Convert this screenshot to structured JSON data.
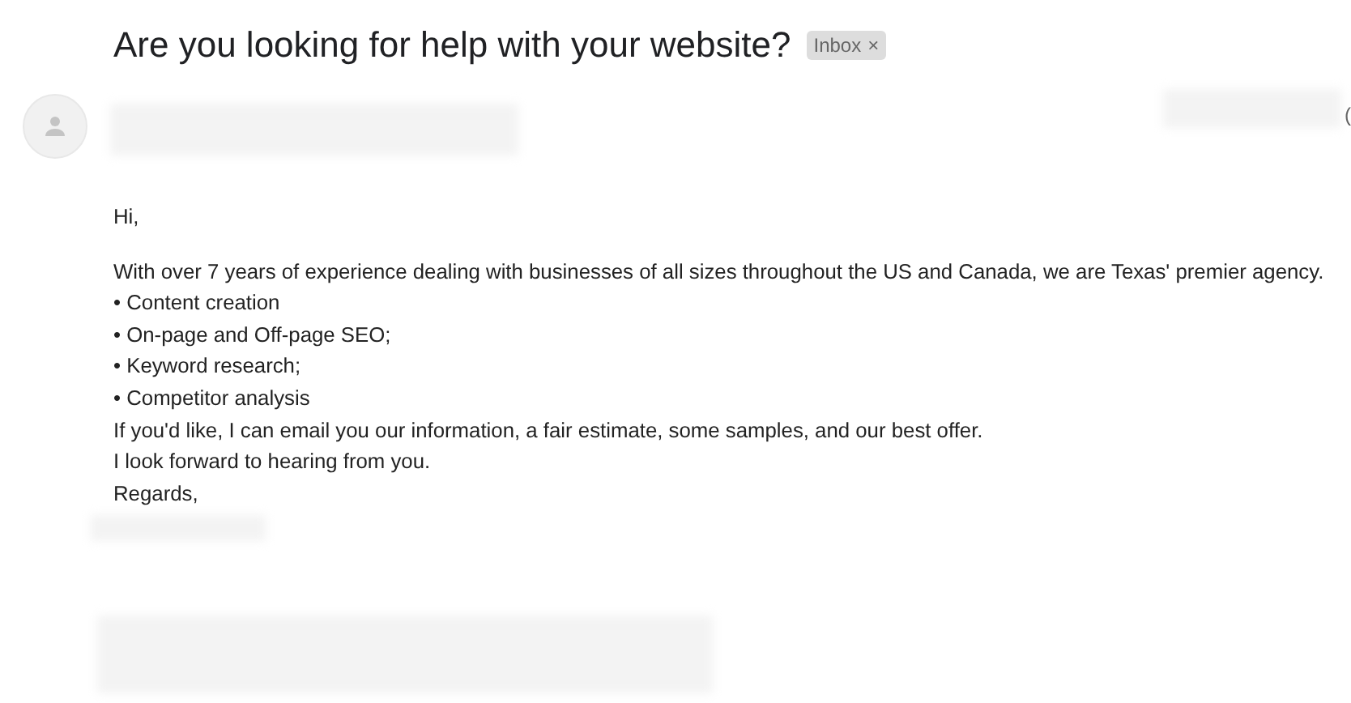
{
  "subject": {
    "title": "Are you looking for help with your website?",
    "label": {
      "text": "Inbox",
      "close": "×"
    }
  },
  "message": {
    "date_fragment": "(",
    "body": [
      "Hi,",
      "With over 7 years of experience dealing with businesses of all sizes throughout the US and Canada, we are Texas' premier agency.",
      "• Content creation",
      "• On-page and Off-page SEO;",
      "• Keyword research;",
      "• Competitor analysis",
      "If you'd like, I can email you our information, a fair estimate, some samples, and our best offer.",
      "I look forward to hearing from you.",
      "Regards,"
    ]
  }
}
